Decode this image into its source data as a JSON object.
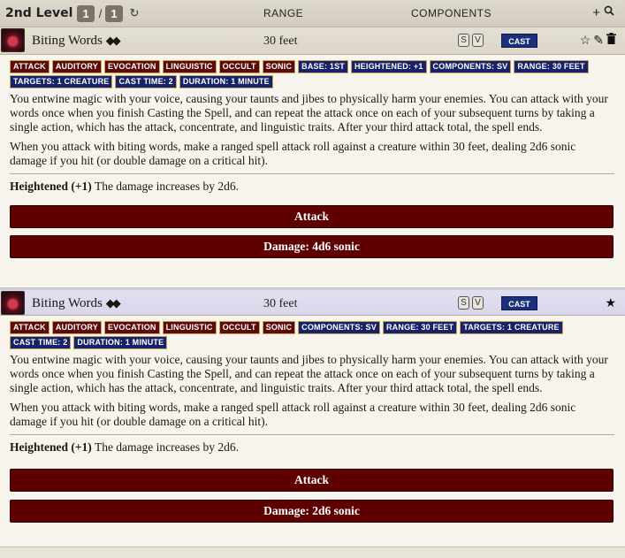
{
  "header": {
    "level_label": "2nd Level",
    "slot_current": "1",
    "slot_separator": "/",
    "slot_max": "1",
    "refresh_glyph": "↻",
    "col_range": "RANGE",
    "col_components": "COMPONENTS",
    "add_glyph": "+",
    "search_glyph": "🔍"
  },
  "spells": [
    {
      "name": "Biting Words",
      "actions_glyph": "◆◆",
      "range": "30 feet",
      "comp_s": "S",
      "comp_v": "V",
      "cast_label": "CAST",
      "star_glyph": "☆",
      "edit_glyph": "✎",
      "delete_glyph": "🗑",
      "traits": [
        {
          "label": "ATTACK",
          "color": "red"
        },
        {
          "label": "AUDITORY",
          "color": "red"
        },
        {
          "label": "EVOCATION",
          "color": "red"
        },
        {
          "label": "LINGUISTIC",
          "color": "red"
        },
        {
          "label": "OCCULT",
          "color": "red"
        },
        {
          "label": "SONIC",
          "color": "red"
        },
        {
          "label": "BASE: 1ST",
          "color": "blue"
        },
        {
          "label": "HEIGHTENED: +1",
          "color": "blue"
        },
        {
          "label": "COMPONENTS: SV",
          "color": "blue"
        },
        {
          "label": "RANGE: 30 FEET",
          "color": "blue"
        },
        {
          "label": "TARGETS: 1 CREATURE",
          "color": "blue"
        },
        {
          "label": "CAST TIME: 2",
          "color": "blue"
        },
        {
          "label": "DURATION: 1 MINUTE",
          "color": "blue"
        }
      ],
      "desc1": "You entwine magic with your voice, causing your taunts and jibes to physically harm your enemies. You can attack with your words once when you finish Casting the Spell, and can repeat the attack once on each of your subsequent turns by taking a single action, which has the attack, concentrate, and linguistic traits. After your third attack total, the spell ends.",
      "desc2": "When you attack with biting words, make a ranged spell attack roll against a creature within 30 feet, dealing 2d6 sonic damage if you hit (or double damage on a critical hit).",
      "heightened_label": "Heightened (+1)",
      "heightened_text": " The damage increases by 2d6.",
      "attack_label": "Attack",
      "damage_label": "Damage: 4d6 sonic"
    },
    {
      "name": "Biting Words",
      "actions_glyph": "◆◆",
      "range": "30 feet",
      "comp_s": "S",
      "comp_v": "V",
      "cast_label": "CAST",
      "star_glyph": "★",
      "traits": [
        {
          "label": "ATTACK",
          "color": "red"
        },
        {
          "label": "AUDITORY",
          "color": "red"
        },
        {
          "label": "EVOCATION",
          "color": "red"
        },
        {
          "label": "LINGUISTIC",
          "color": "red"
        },
        {
          "label": "OCCULT",
          "color": "red"
        },
        {
          "label": "SONIC",
          "color": "red"
        },
        {
          "label": "COMPONENTS: SV",
          "color": "blue"
        },
        {
          "label": "RANGE: 30 FEET",
          "color": "blue"
        },
        {
          "label": "TARGETS: 1 CREATURE",
          "color": "blue"
        },
        {
          "label": "CAST TIME: 2",
          "color": "blue"
        },
        {
          "label": "DURATION: 1 MINUTE",
          "color": "blue"
        }
      ],
      "desc1": "You entwine magic with your voice, causing your taunts and jibes to physically harm your enemies. You can attack with your words once when you finish Casting the Spell, and can repeat the attack once on each of your subsequent turns by taking a single action, which has the attack, concentrate, and linguistic traits. After your third attack total, the spell ends.",
      "desc2": "When you attack with biting words, make a ranged spell attack roll against a creature within 30 feet, dealing 2d6 sonic damage if you hit (or double damage on a critical hit).",
      "heightened_label": "Heightened (+1)",
      "heightened_text": " The damage increases by 2d6.",
      "attack_label": "Attack",
      "damage_label": "Damage: 2d6 sonic"
    }
  ],
  "colors": {
    "trait_red": "#5c0a0a",
    "trait_blue": "#16236b",
    "button_red": "#5e0000",
    "cast_blue": "#1c2f7a"
  }
}
